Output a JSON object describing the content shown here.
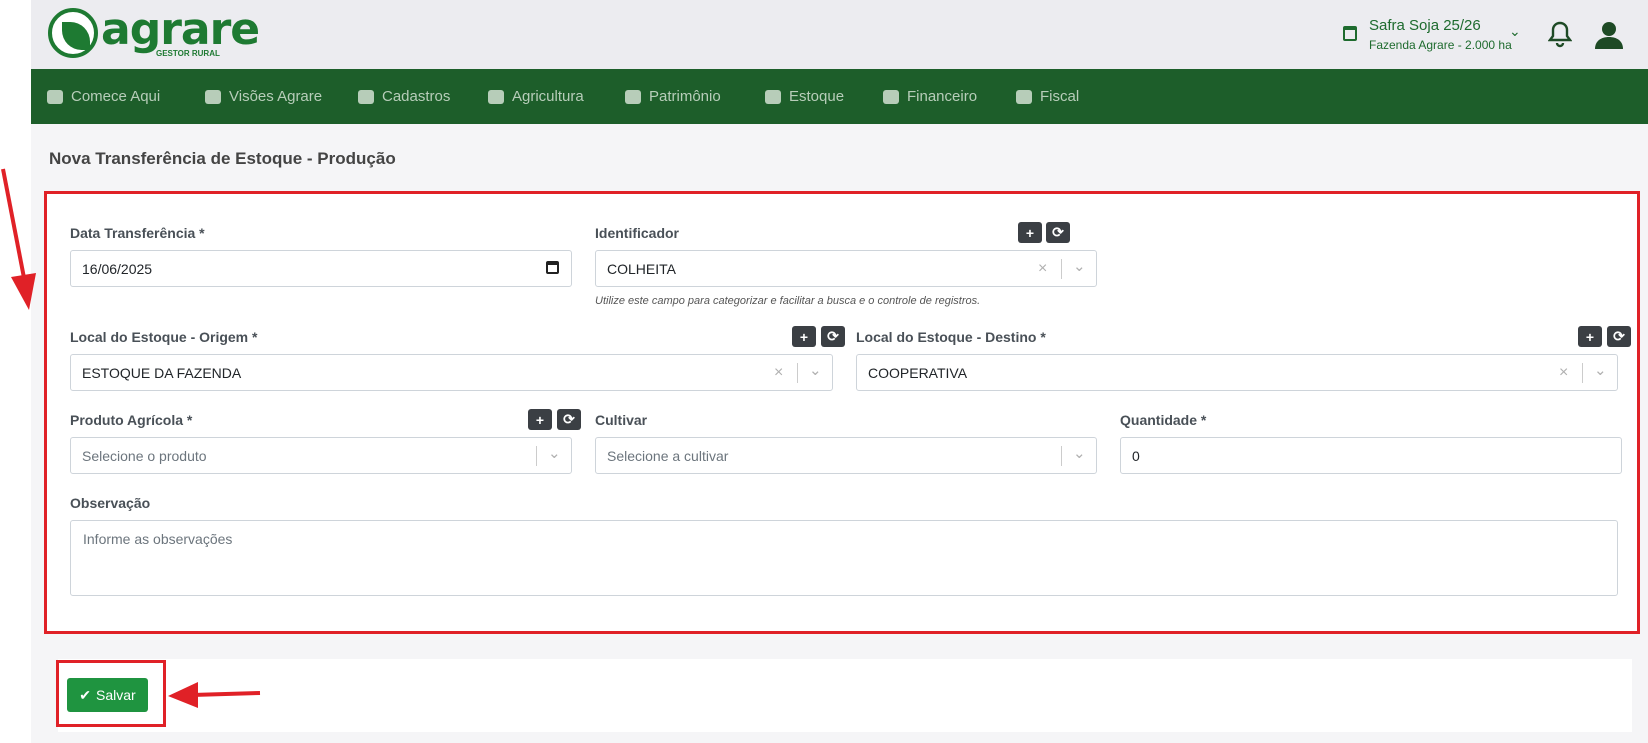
{
  "logo": {
    "word": "agrare",
    "sub": "GESTOR RURAL"
  },
  "header": {
    "safra_title": "Safra Soja 25/26",
    "safra_sub": "Fazenda Agrare - 2.000 ha"
  },
  "nav": [
    {
      "label": "Comece Aqui",
      "icon": "handshake-icon"
    },
    {
      "label": "Visões Agrare",
      "icon": "dashboard-icon"
    },
    {
      "label": "Cadastros",
      "icon": "truck-icon"
    },
    {
      "label": "Agricultura",
      "icon": "leaf-icon"
    },
    {
      "label": "Patrimônio",
      "icon": "tractor-icon"
    },
    {
      "label": "Estoque",
      "icon": "boxes-icon"
    },
    {
      "label": "Financeiro",
      "icon": "money-hand-icon"
    },
    {
      "label": "Fiscal",
      "icon": "invoice-icon"
    }
  ],
  "page": {
    "title": "Nova Transferência de Estoque - Produção"
  },
  "form": {
    "data_label": "Data Transferência *",
    "data_value": "16/06/2025",
    "ident_label": "Identificador",
    "ident_value": "COLHEITA",
    "ident_help": "Utilize este campo para categorizar e facilitar a busca e o controle de registros.",
    "origem_label": "Local do Estoque - Origem *",
    "origem_value": "ESTOQUE DA FAZENDA",
    "destino_label": "Local do Estoque - Destino *",
    "destino_value": "COOPERATIVA",
    "produto_label": "Produto Agrícola *",
    "produto_placeholder": "Selecione o produto",
    "cultivar_label": "Cultivar",
    "cultivar_placeholder": "Selecione a cultivar",
    "qtd_label": "Quantidade *",
    "qtd_value": "0",
    "obs_label": "Observação",
    "obs_placeholder": "Informe as observações",
    "plus": "+",
    "refresh": "⟳",
    "clear": "×",
    "chevron": "⌄"
  },
  "save": {
    "label": "Salvar",
    "check": "✔"
  },
  "colors": {
    "brand": "#1e7a32",
    "nav": "#1d5e2a",
    "highlight": "#e02127",
    "save": "#1f9440"
  }
}
